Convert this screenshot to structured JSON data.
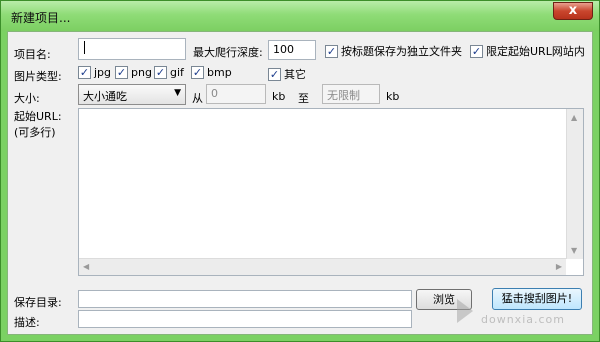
{
  "window": {
    "title": "新建项目..."
  },
  "title_buttons": {
    "close_glyph": "x"
  },
  "fields": {
    "project_name_label": "项目名:",
    "project_name_value": "",
    "depth_label": "最大爬行深度:",
    "depth_value": "100",
    "save_by_title_label": "按标题保存为独立文件夹",
    "limit_url_label": "限定起始URL网站内",
    "image_type_label": "图片类型:",
    "types": [
      {
        "label": "jpg",
        "checked": true
      },
      {
        "label": "png",
        "checked": true
      },
      {
        "label": "gif",
        "checked": true
      },
      {
        "label": "bmp",
        "checked": true
      },
      {
        "label": "其它",
        "checked": true
      }
    ],
    "size_label": "大小:",
    "size_option": "大小通吃",
    "from_label": "从",
    "from_value": "0",
    "kb1": "kb",
    "to_label": "至",
    "to_value": "无限制",
    "kb2": "kb",
    "start_url_label": "起始URL:",
    "start_url_sub": "(可多行)",
    "save_dir_label": "保存目录:",
    "browse_label": "浏览",
    "start_button_label": "猛击搜刮图片!",
    "desc_label": "描述:"
  },
  "watermark": {
    "text": "downxia.com"
  }
}
